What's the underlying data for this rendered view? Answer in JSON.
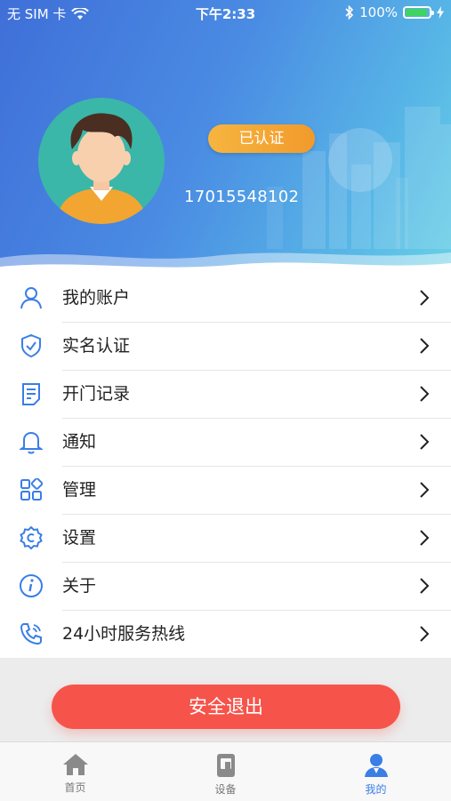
{
  "status_bar": {
    "carrier": "无 SIM 卡",
    "time": "下午2:33",
    "battery": "100%"
  },
  "profile": {
    "badge": "已认证",
    "phone": "17015548102"
  },
  "menu": [
    {
      "label": "我的账户",
      "icon": "user-icon"
    },
    {
      "label": "实名认证",
      "icon": "shield-check-icon"
    },
    {
      "label": "开门记录",
      "icon": "document-icon"
    },
    {
      "label": "通知",
      "icon": "bell-icon"
    },
    {
      "label": "管理",
      "icon": "grid-icon"
    },
    {
      "label": "设置",
      "icon": "settings-icon"
    },
    {
      "label": "关于",
      "icon": "info-icon"
    },
    {
      "label": "24小时服务热线",
      "icon": "phone-icon"
    }
  ],
  "logout_label": "安全退出",
  "tabs": [
    {
      "label": "首页",
      "icon": "home-icon"
    },
    {
      "label": "设备",
      "icon": "device-icon"
    },
    {
      "label": "我的",
      "icon": "profile-icon"
    }
  ],
  "colors": {
    "accent": "#3a7ee6",
    "logout": "#f6544b",
    "badge": "#f4a437"
  }
}
